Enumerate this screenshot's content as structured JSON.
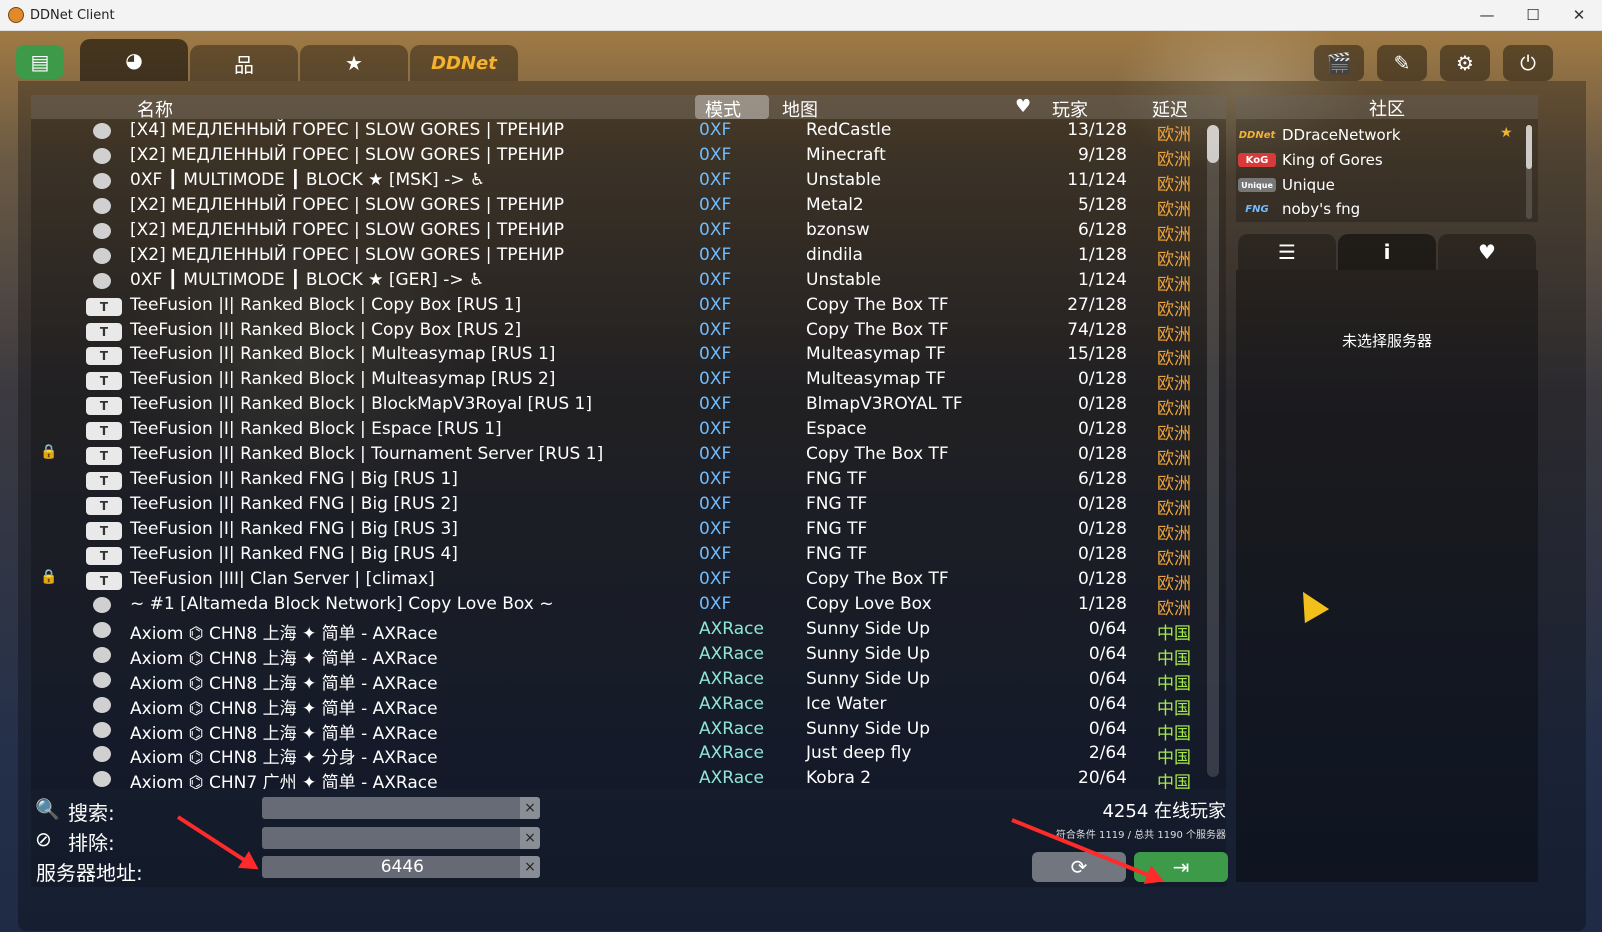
{
  "window": {
    "title": "DDNet Client",
    "minimize": "—",
    "maximize": "☐",
    "close": "✕"
  },
  "tabs": {
    "news_icon": "▤",
    "internet_icon": "◕",
    "lan_icon": "品",
    "favorites_icon": "★",
    "ddnet": "DDNet"
  },
  "top_right": {
    "demos_icon": "🎬",
    "editor_icon": "✎",
    "settings_icon": "⚙",
    "quit_icon": "⏻"
  },
  "columns": {
    "name": "名称",
    "mode": "模式",
    "map": "地图",
    "fav_icon": "♥",
    "players": "玩家",
    "ping": "延迟"
  },
  "colors": {
    "mode_0xf": "#6fbcff",
    "mode_axrace": "#8fe6d8",
    "region_eu": "#f0a53a",
    "region_cn": "#a6e84a",
    "connect": "#3d9a48"
  },
  "servers": [
    {
      "lock": "",
      "icon": "default",
      "name": "[X4] МЕДЛЕННЫЙ ГОРЕС | SLOW GORES | ТРЕНИР",
      "mode": "0XF",
      "map": "RedCastle",
      "players": "13/128",
      "region": "欧洲"
    },
    {
      "lock": "",
      "icon": "default",
      "name": "[X2] МЕДЛЕННЫЙ ГОРЕС | SLOW GORES | ТРЕНИР",
      "mode": "0XF",
      "map": "Minecraft",
      "players": "9/128",
      "region": "欧洲"
    },
    {
      "lock": "",
      "icon": "default",
      "name": "0XF ┃ MULTIMODE ┃ BLOCK ★ [MSK] -> ♿",
      "mode": "0XF",
      "map": "Unstable",
      "players": "11/124",
      "region": "欧洲"
    },
    {
      "lock": "",
      "icon": "default",
      "name": "[X2] МЕДЛЕННЫЙ ГОРЕС | SLOW GORES | ТРЕНИР",
      "mode": "0XF",
      "map": "Metal2",
      "players": "5/128",
      "region": "欧洲"
    },
    {
      "lock": "",
      "icon": "default",
      "name": "[X2] МЕДЛЕННЫЙ ГОРЕС | SLOW GORES | ТРЕНИР",
      "mode": "0XF",
      "map": "bzonsw",
      "players": "6/128",
      "region": "欧洲"
    },
    {
      "lock": "",
      "icon": "default",
      "name": "[X2] МЕДЛЕННЫЙ ГОРЕС | SLOW GORES | ТРЕНИР",
      "mode": "0XF",
      "map": "dindila",
      "players": "1/128",
      "region": "欧洲"
    },
    {
      "lock": "",
      "icon": "default",
      "name": "0XF ┃ MULTIMODE ┃ BLOCK ★ [GER] -> ♿",
      "mode": "0XF",
      "map": "Unstable",
      "players": "1/124",
      "region": "欧洲"
    },
    {
      "lock": "",
      "icon": "tf",
      "name": "TeeFusion |I| Ranked Block | Copy Box [RUS 1]",
      "mode": "0XF",
      "map": "Copy The Box TF",
      "players": "27/128",
      "region": "欧洲"
    },
    {
      "lock": "",
      "icon": "tf",
      "name": "TeeFusion |I| Ranked Block | Copy Box [RUS 2]",
      "mode": "0XF",
      "map": "Copy The Box TF",
      "players": "74/128",
      "region": "欧洲"
    },
    {
      "lock": "",
      "icon": "tf",
      "name": "TeeFusion |I| Ranked Block | Multeasymap [RUS 1]",
      "mode": "0XF",
      "map": "Multeasymap TF",
      "players": "15/128",
      "region": "欧洲"
    },
    {
      "lock": "",
      "icon": "tf",
      "name": "TeeFusion |I| Ranked Block | Multeasymap [RUS 2]",
      "mode": "0XF",
      "map": "Multeasymap TF",
      "players": "0/128",
      "region": "欧洲"
    },
    {
      "lock": "",
      "icon": "tf",
      "name": "TeeFusion |I| Ranked Block | BlockMapV3Royal [RUS 1]",
      "mode": "0XF",
      "map": "BlmapV3ROYAL TF",
      "players": "0/128",
      "region": "欧洲"
    },
    {
      "lock": "",
      "icon": "tf",
      "name": "TeeFusion |I| Ranked Block | Espace [RUS 1]",
      "mode": "0XF",
      "map": "Espace",
      "players": "0/128",
      "region": "欧洲"
    },
    {
      "lock": "🔒",
      "icon": "tf",
      "name": "TeeFusion |I| Ranked Block | Tournament Server [RUS 1]",
      "mode": "0XF",
      "map": "Copy The Box TF",
      "players": "0/128",
      "region": "欧洲"
    },
    {
      "lock": "",
      "icon": "tf",
      "name": "TeeFusion |I| Ranked FNG | Big [RUS 1]",
      "mode": "0XF",
      "map": "FNG TF",
      "players": "6/128",
      "region": "欧洲"
    },
    {
      "lock": "",
      "icon": "tf",
      "name": "TeeFusion |I| Ranked FNG | Big [RUS 2]",
      "mode": "0XF",
      "map": "FNG TF",
      "players": "0/128",
      "region": "欧洲"
    },
    {
      "lock": "",
      "icon": "tf",
      "name": "TeeFusion |I| Ranked FNG | Big [RUS 3]",
      "mode": "0XF",
      "map": "FNG TF",
      "players": "0/128",
      "region": "欧洲"
    },
    {
      "lock": "",
      "icon": "tf",
      "name": "TeeFusion |I| Ranked FNG | Big [RUS 4]",
      "mode": "0XF",
      "map": "FNG TF",
      "players": "0/128",
      "region": "欧洲"
    },
    {
      "lock": "🔒",
      "icon": "tf",
      "name": "TeeFusion |III| Clan Server | [climax]",
      "mode": "0XF",
      "map": "Copy The Box TF",
      "players": "0/128",
      "region": "欧洲"
    },
    {
      "lock": "",
      "icon": "default",
      "name": "~ #1 [Altameda Block Network] Copy Love Box ~",
      "mode": "0XF",
      "map": "Copy Love Box",
      "players": "1/128",
      "region": "欧洲"
    },
    {
      "lock": "",
      "icon": "default",
      "name": "Axiom ⌬ CHN8 上海 ✦ 简单 - AXRace",
      "mode": "AXRace",
      "map": "Sunny Side Up",
      "players": "0/64",
      "region": "中国"
    },
    {
      "lock": "",
      "icon": "default",
      "name": "Axiom ⌬ CHN8 上海 ✦ 简单 - AXRace",
      "mode": "AXRace",
      "map": "Sunny Side Up",
      "players": "0/64",
      "region": "中国"
    },
    {
      "lock": "",
      "icon": "default",
      "name": "Axiom ⌬ CHN8 上海 ✦ 简单 - AXRace",
      "mode": "AXRace",
      "map": "Sunny Side Up",
      "players": "0/64",
      "region": "中国"
    },
    {
      "lock": "",
      "icon": "default",
      "name": "Axiom ⌬ CHN8 上海 ✦ 简单 - AXRace",
      "mode": "AXRace",
      "map": "Ice Water",
      "players": "0/64",
      "region": "中国"
    },
    {
      "lock": "",
      "icon": "default",
      "name": "Axiom ⌬ CHN8 上海 ✦ 简单 - AXRace",
      "mode": "AXRace",
      "map": "Sunny Side Up",
      "players": "0/64",
      "region": "中国"
    },
    {
      "lock": "",
      "icon": "default",
      "name": "Axiom ⌬ CHN8 上海 ✦ 分身 - AXRace",
      "mode": "AXRace",
      "map": "Just deep fly",
      "players": "2/64",
      "region": "中国"
    },
    {
      "lock": "",
      "icon": "default",
      "name": "Axiom ⌬ CHN7 广州 ✦ 简单 - AXRace",
      "mode": "AXRace",
      "map": "Kobra 2",
      "players": "20/64",
      "region": "中国"
    }
  ],
  "filters": {
    "search_icon": "🔍",
    "search_label": "搜索:",
    "search_value": "",
    "exclude_icon": "⊘",
    "exclude_label": "排除:",
    "exclude_value": "",
    "address_label": "服务器地址:",
    "address_value": "6446",
    "clear": "×"
  },
  "stats": {
    "online": "4254 在线玩家",
    "summary": "符合条件 1119 / 总共 1190 个服务器"
  },
  "buttons": {
    "refresh_icon": "⟳",
    "connect_icon": "⇥"
  },
  "community": {
    "title": "社区",
    "items": [
      {
        "logo": "DDNet",
        "name": "DDraceNetwork",
        "star": "★"
      },
      {
        "logo": "KoG",
        "name": "King of Gores",
        "star": ""
      },
      {
        "logo": "Unique",
        "name": "Unique",
        "star": ""
      },
      {
        "logo": "FNG",
        "name": "noby's fng",
        "star": ""
      }
    ]
  },
  "info_tabs": {
    "list_icon": "☰",
    "info_icon": "i",
    "friends_icon": "♥"
  },
  "info": {
    "no_server": "未选择服务器"
  }
}
